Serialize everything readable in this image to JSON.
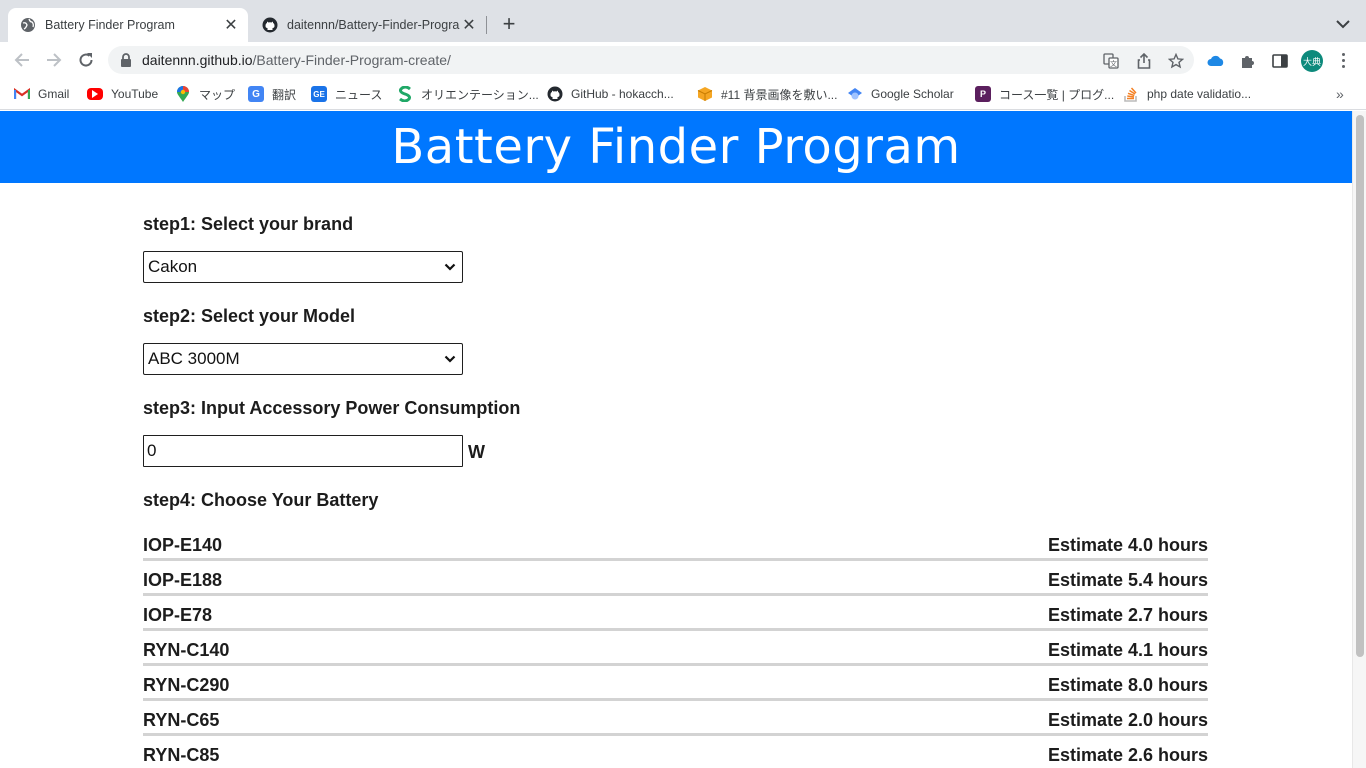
{
  "browser": {
    "tabs": [
      {
        "title": "Battery Finder Program",
        "active": true
      },
      {
        "title": "daitennn/Battery-Finder-Program-create",
        "active": false
      }
    ],
    "url_host": "daitennn.github.io",
    "url_path": "/Battery-Finder-Program-create/",
    "avatar_initials": "大典",
    "bookmarks": [
      {
        "label": "Gmail",
        "icon": "gmail-icon"
      },
      {
        "label": "YouTube",
        "icon": "youtube-icon"
      },
      {
        "label": "マップ",
        "icon": "maps-icon"
      },
      {
        "label": "翻訳",
        "icon": "translate-icon"
      },
      {
        "label": "ニュース",
        "icon": "news-icon"
      },
      {
        "label": "オリエンテーション...",
        "icon": "orientation-icon"
      },
      {
        "label": "GitHub - hokacch...",
        "icon": "github-icon"
      },
      {
        "label": "#11 背景画像を敷い...",
        "icon": "box-icon"
      },
      {
        "label": "Google Scholar",
        "icon": "scholar-icon"
      },
      {
        "label": "コース一覧 | プログ...",
        "icon": "course-icon"
      },
      {
        "label": "php date validatio...",
        "icon": "stackoverflow-icon"
      }
    ]
  },
  "page": {
    "title": "Battery Finder Program",
    "step1_label": "step1: Select your brand",
    "brand_selected": "Cakon",
    "step2_label": "step2: Select your Model",
    "model_selected": "ABC 3000M",
    "step3_label": "step3: Input Accessory Power Consumption",
    "power_value": "0",
    "power_unit": "W",
    "step4_label": "step4: Choose Your Battery",
    "batteries": [
      {
        "name": "IOP-E140",
        "estimate": "Estimate 4.0 hours"
      },
      {
        "name": "IOP-E188",
        "estimate": "Estimate 5.4 hours"
      },
      {
        "name": "IOP-E78",
        "estimate": "Estimate 2.7 hours"
      },
      {
        "name": "RYN-C140",
        "estimate": "Estimate 4.1 hours"
      },
      {
        "name": "RYN-C290",
        "estimate": "Estimate 8.0 hours"
      },
      {
        "name": "RYN-C65",
        "estimate": "Estimate 2.0 hours"
      },
      {
        "name": "RYN-C85",
        "estimate": "Estimate 2.6 hours"
      }
    ]
  },
  "colors": {
    "header_blue": "#0077ff",
    "row_border": "#d3d3d3"
  }
}
